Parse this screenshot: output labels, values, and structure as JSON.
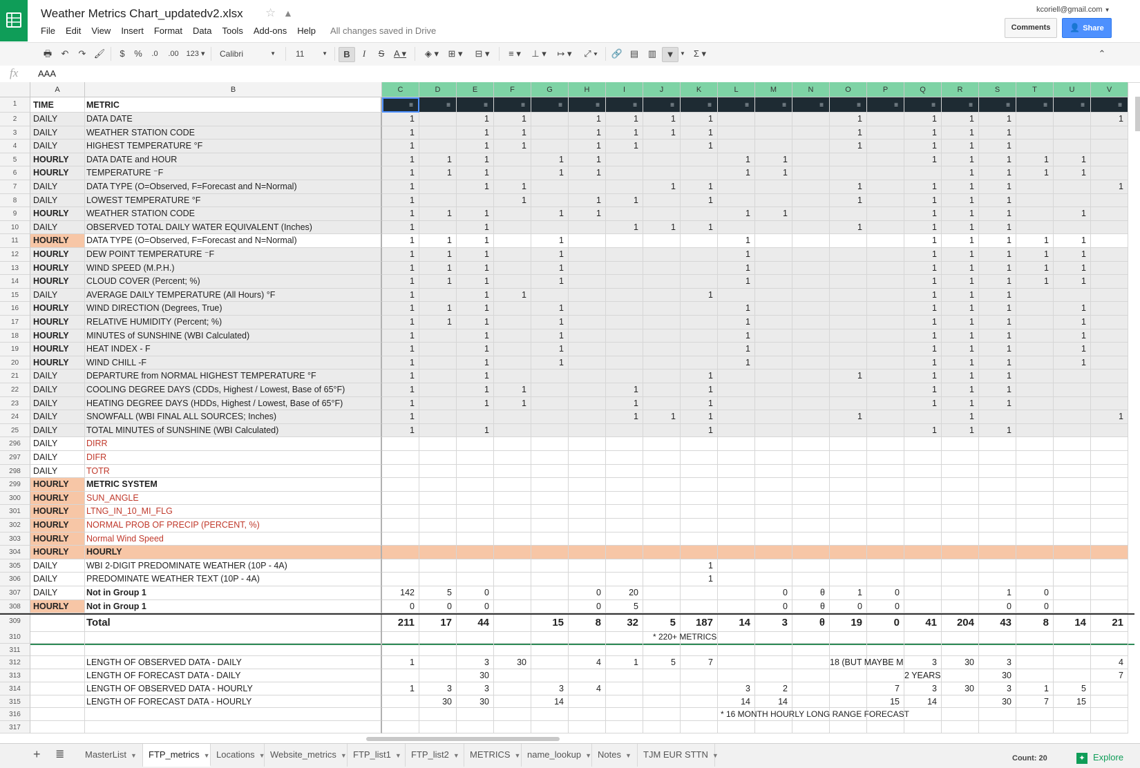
{
  "app": {
    "title": "Weather Metrics Chart_updatedv2.xlsx",
    "saved_status": "All changes saved in Drive",
    "account": "kcoriell@gmail.com",
    "comments_label": "Comments",
    "share_label": "Share",
    "menu": [
      "File",
      "Edit",
      "View",
      "Insert",
      "Format",
      "Data",
      "Tools",
      "Add-ons",
      "Help"
    ]
  },
  "toolbar": {
    "font": "Calibri",
    "font_size": "11",
    "currency": "$",
    "percent": "%",
    "dec_less": ".0",
    "dec_more": ".00",
    "more_formats": "123"
  },
  "formula": {
    "fx": "fx",
    "value": "AAA"
  },
  "columns": {
    "A": "A",
    "B": "B",
    "data": [
      "C",
      "D",
      "E",
      "F",
      "G",
      "H",
      "I",
      "J",
      "K",
      "L",
      "M",
      "N",
      "O",
      "P",
      "Q",
      "R",
      "S",
      "T",
      "U",
      "V"
    ]
  },
  "header_row": {
    "num": "1",
    "a": "TIME",
    "b": "METRIC"
  },
  "rows": [
    {
      "n": "2",
      "a": "DAILY",
      "b": "DATA DATE",
      "v": [
        "1",
        "",
        "1",
        "1",
        "",
        "1",
        "1",
        "1",
        "1",
        "",
        "",
        "",
        "1",
        "",
        "1",
        "1",
        "1",
        "",
        "",
        "1"
      ]
    },
    {
      "n": "3",
      "a": "DAILY",
      "b": "WEATHER STATION CODE",
      "v": [
        "1",
        "",
        "1",
        "1",
        "",
        "1",
        "1",
        "1",
        "1",
        "",
        "",
        "",
        "1",
        "",
        "1",
        "1",
        "1",
        "",
        "",
        ""
      ]
    },
    {
      "n": "4",
      "a": "DAILY",
      "b": "HIGHEST TEMPERATURE °F",
      "v": [
        "1",
        "",
        "1",
        "1",
        "",
        "1",
        "1",
        "",
        "1",
        "",
        "",
        "",
        "1",
        "",
        "1",
        "1",
        "1",
        "",
        "",
        ""
      ]
    },
    {
      "n": "5",
      "a": "HOURLY",
      "b": "DATA DATE and HOUR",
      "v": [
        "1",
        "1",
        "1",
        "",
        "1",
        "1",
        "",
        "",
        "",
        "1",
        "1",
        "",
        "",
        "",
        "1",
        "1",
        "1",
        "1",
        "1",
        ""
      ]
    },
    {
      "n": "6",
      "a": "HOURLY",
      "b": "TEMPERATURE ⁻F",
      "v": [
        "1",
        "1",
        "1",
        "",
        "1",
        "1",
        "",
        "",
        "",
        "1",
        "1",
        "",
        "",
        "",
        "",
        "1",
        "1",
        "1",
        "1",
        ""
      ]
    },
    {
      "n": "7",
      "a": "DAILY",
      "b": "DATA TYPE (O=Observed, F=Forecast and N=Normal)",
      "v": [
        "1",
        "",
        "1",
        "1",
        "",
        "",
        "",
        "1",
        "1",
        "",
        "",
        "",
        "1",
        "",
        "1",
        "1",
        "1",
        "",
        "",
        "1"
      ]
    },
    {
      "n": "8",
      "a": "DAILY",
      "b": "LOWEST TEMPERATURE °F",
      "v": [
        "1",
        "",
        "",
        "1",
        "",
        "1",
        "1",
        "",
        "1",
        "",
        "",
        "",
        "1",
        "",
        "1",
        "1",
        "1",
        "",
        "",
        ""
      ]
    },
    {
      "n": "9",
      "a": "HOURLY",
      "b": "WEATHER STATION CODE",
      "v": [
        "1",
        "1",
        "1",
        "",
        "1",
        "1",
        "",
        "",
        "",
        "1",
        "1",
        "",
        "",
        "",
        "1",
        "1",
        "1",
        "",
        "1",
        ""
      ]
    },
    {
      "n": "10",
      "a": "DAILY",
      "b": "OBSERVED TOTAL DAILY WATER EQUIVALENT (Inches)",
      "v": [
        "1",
        "",
        "1",
        "",
        "",
        "",
        "1",
        "1",
        "1",
        "",
        "",
        "",
        "1",
        "",
        "1",
        "1",
        "1",
        "",
        "",
        ""
      ]
    },
    {
      "n": "11",
      "a": "HOURLY",
      "b": "DATA TYPE (O=Observed, F=Forecast and N=Normal)",
      "v": [
        "1",
        "1",
        "1",
        "",
        "1",
        "",
        "",
        "",
        "",
        "1",
        "",
        "",
        "",
        "",
        "1",
        "1",
        "1",
        "1",
        "1",
        ""
      ]
    },
    {
      "n": "12",
      "a": "HOURLY",
      "b": "DEW POINT TEMPERATURE ⁻F",
      "v": [
        "1",
        "1",
        "1",
        "",
        "1",
        "",
        "",
        "",
        "",
        "1",
        "",
        "",
        "",
        "",
        "1",
        "1",
        "1",
        "1",
        "1",
        ""
      ]
    },
    {
      "n": "13",
      "a": "HOURLY",
      "b": "WIND SPEED (M.P.H.)",
      "v": [
        "1",
        "1",
        "1",
        "",
        "1",
        "",
        "",
        "",
        "",
        "1",
        "",
        "",
        "",
        "",
        "1",
        "1",
        "1",
        "1",
        "1",
        ""
      ]
    },
    {
      "n": "14",
      "a": "HOURLY",
      "b": "CLOUD COVER (Percent; %)",
      "v": [
        "1",
        "1",
        "1",
        "",
        "1",
        "",
        "",
        "",
        "",
        "1",
        "",
        "",
        "",
        "",
        "1",
        "1",
        "1",
        "1",
        "1",
        ""
      ]
    },
    {
      "n": "15",
      "a": "DAILY",
      "b": "AVERAGE DAILY TEMPERATURE (All Hours) °F",
      "v": [
        "1",
        "",
        "1",
        "1",
        "",
        "",
        "",
        "",
        "1",
        "",
        "",
        "",
        "",
        "",
        "1",
        "1",
        "1",
        "",
        "",
        ""
      ]
    },
    {
      "n": "16",
      "a": "HOURLY",
      "b": "WIND DIRECTION  (Degrees, True)",
      "v": [
        "1",
        "1",
        "1",
        "",
        "1",
        "",
        "",
        "",
        "",
        "1",
        "",
        "",
        "",
        "",
        "1",
        "1",
        "1",
        "",
        "1",
        ""
      ]
    },
    {
      "n": "17",
      "a": "HOURLY",
      "b": "RELATIVE HUMIDITY (Percent; %)",
      "v": [
        "1",
        "1",
        "1",
        "",
        "1",
        "",
        "",
        "",
        "",
        "1",
        "",
        "",
        "",
        "",
        "1",
        "1",
        "1",
        "",
        "1",
        ""
      ]
    },
    {
      "n": "18",
      "a": "HOURLY",
      "b": "MINUTES of SUNSHINE (WBI Calculated)",
      "v": [
        "1",
        "",
        "1",
        "",
        "1",
        "",
        "",
        "",
        "",
        "1",
        "",
        "",
        "",
        "",
        "1",
        "1",
        "1",
        "",
        "1",
        ""
      ]
    },
    {
      "n": "19",
      "a": "HOURLY",
      "b": "HEAT INDEX - F",
      "v": [
        "1",
        "",
        "1",
        "",
        "1",
        "",
        "",
        "",
        "",
        "1",
        "",
        "",
        "",
        "",
        "1",
        "1",
        "1",
        "",
        "1",
        ""
      ]
    },
    {
      "n": "20",
      "a": "HOURLY",
      "b": "WIND CHILL -F",
      "v": [
        "1",
        "",
        "1",
        "",
        "1",
        "",
        "",
        "",
        "",
        "1",
        "",
        "",
        "",
        "",
        "1",
        "1",
        "1",
        "",
        "1",
        ""
      ]
    },
    {
      "n": "21",
      "a": "DAILY",
      "b": "DEPARTURE from NORMAL HIGHEST TEMPERATURE °F",
      "v": [
        "1",
        "",
        "1",
        "",
        "",
        "",
        "",
        "",
        "1",
        "",
        "",
        "",
        "1",
        "",
        "1",
        "1",
        "1",
        "",
        "",
        ""
      ]
    },
    {
      "n": "22",
      "a": "DAILY",
      "b": "COOLING DEGREE DAYS (CDDs, Highest / Lowest, Base of 65°F)",
      "v": [
        "1",
        "",
        "1",
        "1",
        "",
        "",
        "1",
        "",
        "1",
        "",
        "",
        "",
        "",
        "",
        "1",
        "1",
        "1",
        "",
        "",
        ""
      ]
    },
    {
      "n": "23",
      "a": "DAILY",
      "b": "HEATING DEGREE DAYS (HDDs, Highest / Lowest, Base of 65°F)",
      "v": [
        "1",
        "",
        "1",
        "1",
        "",
        "",
        "1",
        "",
        "1",
        "",
        "",
        "",
        "",
        "",
        "1",
        "1",
        "1",
        "",
        "",
        ""
      ]
    },
    {
      "n": "24",
      "a": "DAILY",
      "b": "SNOWFALL (WBI FINAL ALL SOURCES; Inches)",
      "v": [
        "1",
        "",
        "",
        "",
        "",
        "",
        "1",
        "1",
        "1",
        "",
        "",
        "",
        "1",
        "",
        "",
        "1",
        "",
        "",
        "",
        "1"
      ]
    },
    {
      "n": "25",
      "a": "DAILY",
      "b": "TOTAL MINUTES of SUNSHINE (WBI Calculated)",
      "v": [
        "1",
        "",
        "1",
        "",
        "",
        "",
        "",
        "",
        "1",
        "",
        "",
        "",
        "",
        "",
        "1",
        "1",
        "1",
        "",
        "",
        ""
      ]
    },
    {
      "n": "296",
      "a": "DAILY",
      "b": "DIRR",
      "red": true,
      "v": []
    },
    {
      "n": "297",
      "a": "DAILY",
      "b": "DIFR",
      "red": true,
      "v": []
    },
    {
      "n": "298",
      "a": "DAILY",
      "b": "TOTR",
      "red": true,
      "v": []
    },
    {
      "n": "299",
      "a": "HOURLY",
      "b": "METRIC SYSTEM",
      "bold": true,
      "v": []
    },
    {
      "n": "300",
      "a": "HOURLY",
      "b": "SUN_ANGLE",
      "red": true,
      "v": []
    },
    {
      "n": "301",
      "a": "HOURLY",
      "b": "LTNG_IN_10_MI_FLG",
      "red": true,
      "v": []
    },
    {
      "n": "302",
      "a": "HOURLY",
      "b": "NORMAL PROB OF PRECIP (PERCENT, %)",
      "red": true,
      "v": []
    },
    {
      "n": "303",
      "a": "HOURLY",
      "b": "Normal Wind Speed",
      "red": true,
      "v": []
    },
    {
      "n": "304",
      "a": "HOURLY",
      "b": "HOURLY",
      "bold": true,
      "fullhl": true,
      "v": []
    },
    {
      "n": "305",
      "a": "DAILY",
      "b": "WBI 2-DIGIT PREDOMINATE WEATHER (10P - 4A)",
      "v": [
        "",
        "",
        "",
        "",
        "",
        "",
        "",
        "",
        "1",
        "",
        "",
        "",
        "",
        "",
        "",
        "",
        "",
        "",
        "",
        ""
      ]
    },
    {
      "n": "306",
      "a": "DAILY",
      "b": "PREDOMINATE WEATHER TEXT  (10P - 4A)",
      "v": [
        "",
        "",
        "",
        "",
        "",
        "",
        "",
        "",
        "1",
        "",
        "",
        "",
        "",
        "",
        "",
        "",
        "",
        "",
        "",
        ""
      ]
    },
    {
      "n": "307",
      "a": "DAILY",
      "b": "Not in Group 1",
      "bold": true,
      "v": [
        "142",
        "5",
        "0",
        "",
        "",
        "0",
        "20",
        "",
        "",
        "",
        "0",
        "θ",
        "1",
        "0",
        "",
        "",
        "1",
        "0",
        "",
        ""
      ]
    },
    {
      "n": "308",
      "a": "HOURLY",
      "b": "Not in Group 1",
      "bold": true,
      "v": [
        "0",
        "0",
        "0",
        "",
        "",
        "0",
        "5",
        "",
        "",
        "",
        "0",
        "θ",
        "0",
        "0",
        "",
        "",
        "0",
        "0",
        "",
        ""
      ]
    }
  ],
  "total_row": {
    "n": "309",
    "b": "Total",
    "v": [
      "211",
      "17",
      "44",
      "",
      "15",
      "8",
      "32",
      "5",
      "187",
      "14",
      "3",
      "θ",
      "19",
      "0",
      "41",
      "204",
      "43",
      "8",
      "14",
      "21"
    ]
  },
  "row310": {
    "n": "310",
    "note": "* 220+ METRICS"
  },
  "row311": {
    "n": "311"
  },
  "lower_rows": [
    {
      "n": "312",
      "b": "LENGTH OF OBSERVED DATA - DAILY",
      "v": [
        "1",
        "",
        "3",
        "30",
        "",
        "4",
        "1",
        "5",
        "7",
        "",
        "",
        "",
        "18 (BUT MAYBE M",
        "",
        "3",
        "30",
        "3",
        "",
        "",
        "4"
      ]
    },
    {
      "n": "313",
      "b": "LENGTH OF FORECAST DATA - DAILY",
      "v": [
        "",
        "",
        "30",
        "",
        "",
        "",
        "",
        "",
        "",
        "",
        "",
        "",
        "",
        "",
        "2 YEARS",
        "",
        "30",
        "",
        "",
        "7"
      ]
    },
    {
      "n": "314",
      "b": "LENGTH OF OBSERVED DATA - HOURLY",
      "v": [
        "1",
        "3",
        "3",
        "",
        "3",
        "4",
        "",
        "",
        "",
        "3",
        "2",
        "",
        "",
        "7",
        "3",
        "30",
        "3",
        "1",
        "5",
        ""
      ]
    },
    {
      "n": "315",
      "b": "LENGTH OF FORECAST DATA - HOURLY",
      "v": [
        "",
        "30",
        "30",
        "",
        "14",
        "",
        "",
        "",
        "",
        "14",
        "14",
        "",
        "",
        "15",
        "14",
        "",
        "30",
        "7",
        "15",
        ""
      ]
    }
  ],
  "row316": {
    "n": "316",
    "note": "* 16 MONTH HOURLY LONG RANGE FORECAST"
  },
  "row317": {
    "n": "317"
  },
  "tabs": [
    "MasterList",
    "FTP_metrics",
    "Locations",
    "Website_metrics",
    "FTP_list1",
    "FTP_list2",
    "METRICS",
    "name_lookup",
    "Notes",
    "TJM EUR STTN"
  ],
  "active_tab": "FTP_metrics",
  "status": {
    "count": "Count: 20",
    "explore": "Explore"
  },
  "colors": {
    "brand_green": "#0f9d58",
    "hourly_bg": "#f7c6a6",
    "selected_col": "#7ed3a5",
    "share_blue": "#4d90fe",
    "red_text": "#c0392b"
  }
}
